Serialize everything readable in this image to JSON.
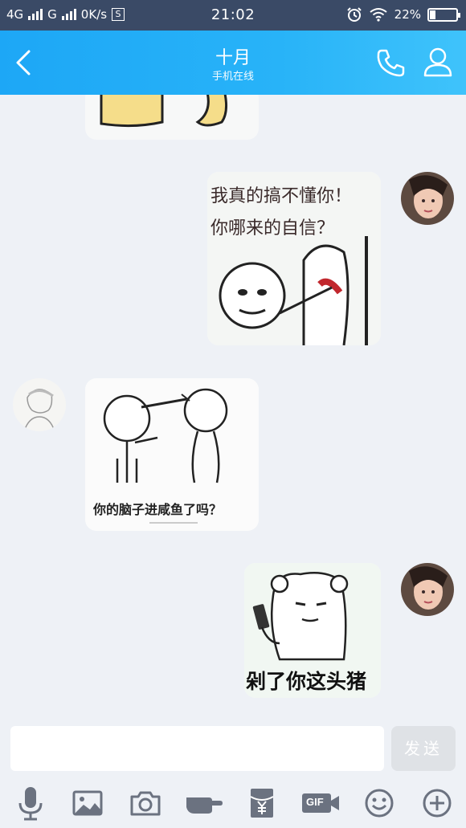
{
  "status_bar": {
    "network_4g": "4G",
    "network_g": "G",
    "data_speed": "0K/s",
    "s_badge": "S",
    "time": "21:02",
    "battery_percent": "22%",
    "battery_level": 0.22
  },
  "header": {
    "title": "十月",
    "subtitle": "手机在线"
  },
  "messages": [
    {
      "side": "received",
      "type": "sticker",
      "caption": ""
    },
    {
      "side": "sent",
      "type": "sticker",
      "caption_line1": "我真的搞不懂你！",
      "caption_line2": "你哪来的自信？"
    },
    {
      "side": "received",
      "type": "sticker",
      "caption": "你的脑子进咸鱼了吗？"
    },
    {
      "side": "sent",
      "type": "sticker",
      "caption": "剁了你这头猪"
    }
  ],
  "composer": {
    "input_value": "",
    "input_placeholder": "",
    "send_label": "发送"
  },
  "toolbar": {
    "gif_label": "GIF",
    "items": [
      "microphone-icon",
      "image-icon",
      "camera-icon",
      "poke-icon",
      "red-packet-icon",
      "gif-icon",
      "emoji-icon",
      "plus-icon"
    ]
  },
  "colors": {
    "header_start": "#1da7f6",
    "header_end": "#3fc3fb",
    "status_bar": "#3a4a66",
    "chat_background": "#eef1f6",
    "send_disabled": "#dfe2e6"
  }
}
